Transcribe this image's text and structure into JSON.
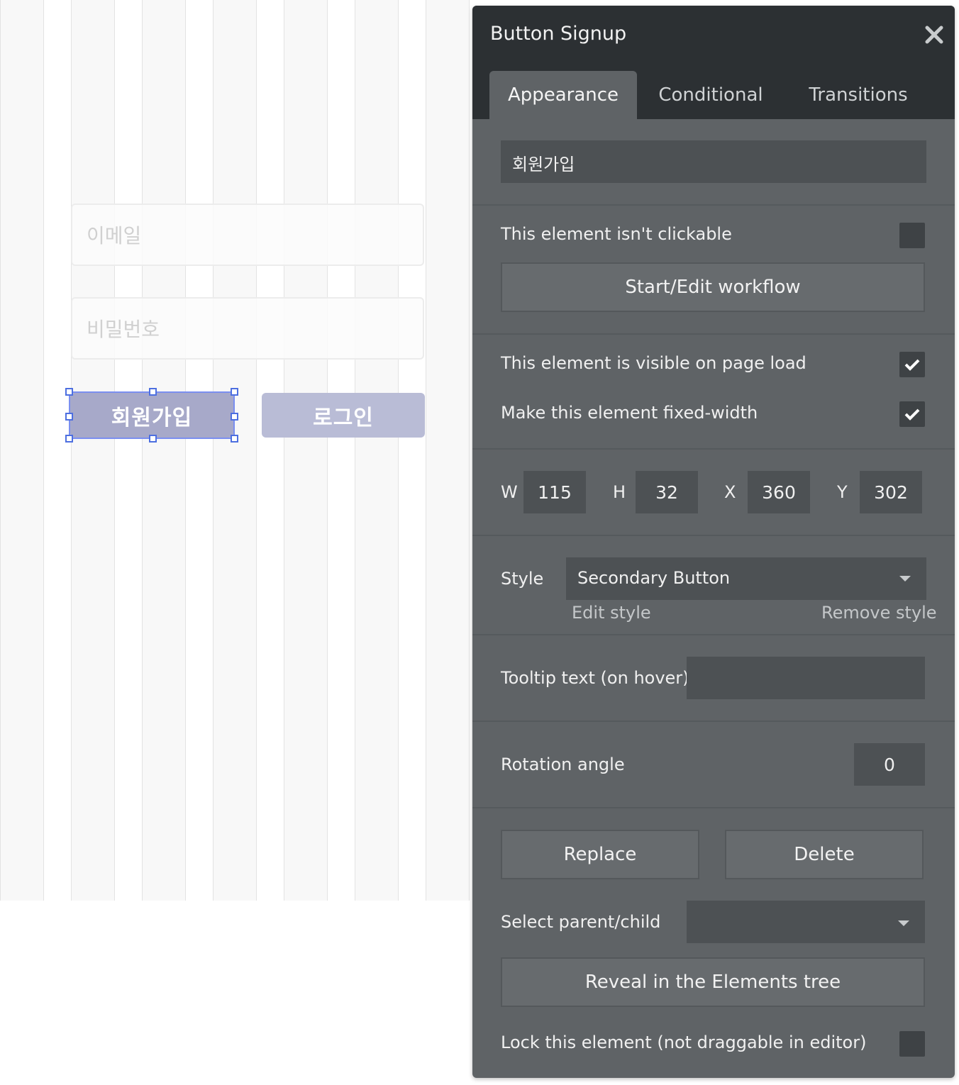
{
  "canvas": {
    "email_placeholder": "이메일",
    "password_placeholder": "비밀번호",
    "signup_button_label": "회원가입",
    "login_button_label": "로그인",
    "signup_button_color": "#a7a9c9",
    "login_button_color": "#b9bcd6",
    "selection_color": "#4d6fe0"
  },
  "panel": {
    "title": "Button Signup",
    "tabs": [
      {
        "label": "Appearance",
        "active": true
      },
      {
        "label": "Conditional",
        "active": false
      },
      {
        "label": "Transitions",
        "active": false
      }
    ],
    "text_value": "회원가입",
    "not_clickable_label": "This element isn't clickable",
    "not_clickable_checked": false,
    "workflow_button_label": "Start/Edit workflow",
    "visible_on_load_label": "This element is visible on page load",
    "visible_on_load_checked": true,
    "fixed_width_label": "Make this element fixed-width",
    "fixed_width_checked": true,
    "dimensions": {
      "w_label": "W",
      "w_value": "115",
      "h_label": "H",
      "h_value": "32",
      "x_label": "X",
      "x_value": "360",
      "y_label": "Y",
      "y_value": "302"
    },
    "style_label": "Style",
    "style_value": "Secondary Button",
    "edit_style_label": "Edit style",
    "remove_style_label": "Remove style",
    "tooltip_label": "Tooltip text (on hover)",
    "tooltip_value": "",
    "rotation_label": "Rotation angle",
    "rotation_value": "0",
    "replace_label": "Replace",
    "delete_label": "Delete",
    "select_parent_label": "Select parent/child",
    "select_parent_value": "",
    "reveal_label": "Reveal in the Elements tree",
    "lock_label": "Lock this element (not draggable in editor)",
    "lock_checked": false
  },
  "colors": {
    "panel_bg": "#5f6366",
    "panel_header_bg": "#2c3033",
    "input_bg": "#4d5154"
  }
}
